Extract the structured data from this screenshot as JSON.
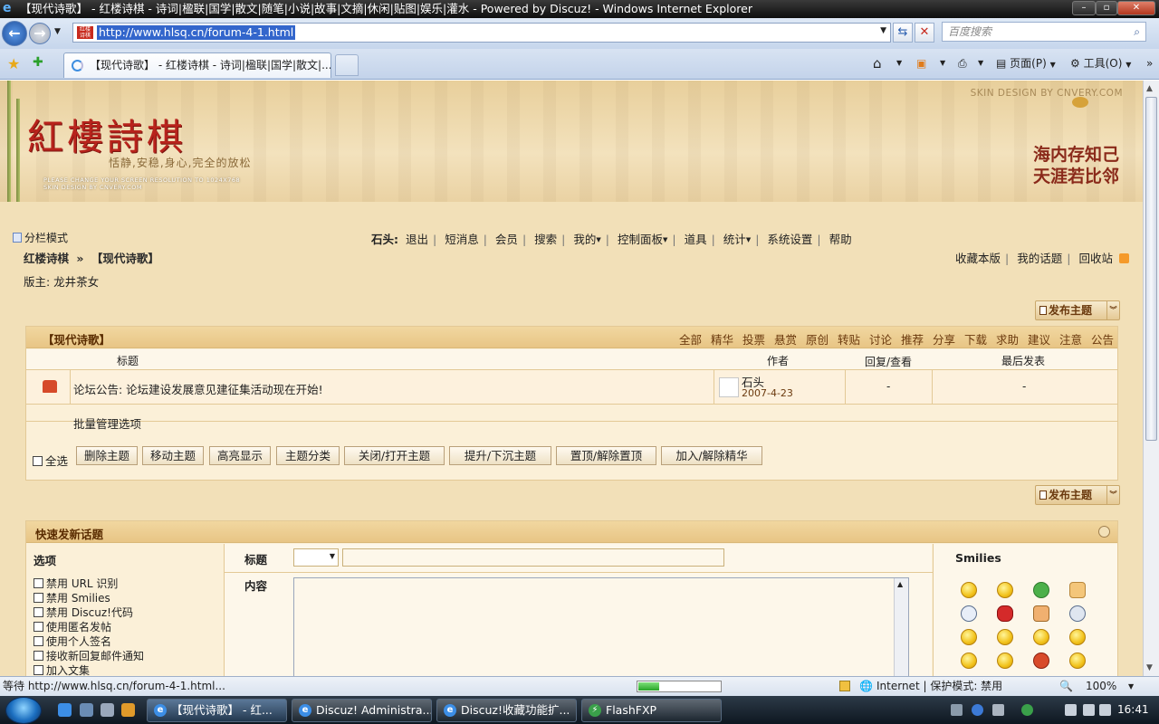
{
  "window": {
    "title": "【现代诗歌】 - 红楼诗棋 - 诗词|楹联|国学|散文|随笔|小说|故事|文摘|休闲|贴图|娱乐|灌水 - Powered by Discuz! - Windows Internet Explorer"
  },
  "address": {
    "url": "http://www.hlsq.cn/forum-4-1.html",
    "search_placeholder": "百度搜索"
  },
  "tabs": {
    "active_label": "【现代诗歌】 - 红楼诗棋 - 诗词|楹联|国学|散文|...",
    "page_menu": "页面(P)",
    "tools_menu": "工具(O)"
  },
  "banner": {
    "logo": "紅樓詩棋",
    "motto": "恬静,安稳,身心,完全的放松",
    "resolution_note": "PLEASE CHANGE YOUR SCREEN RESOLUTION TO 1024X768",
    "skin_note": "SKIN DESIGN BY CNVERY.COM",
    "skin_credit": "SKIN DESIGN BY CNVERY.COM",
    "poem_line1": "海内存知己",
    "poem_line2": "天涯若比邻"
  },
  "toolbar": {
    "split_mode": "分栏模式",
    "username": "石头:",
    "items": [
      "退出",
      "短消息",
      "会员",
      "搜索",
      "我的",
      "控制面板",
      "道具",
      "统计",
      "系统设置",
      "帮助"
    ]
  },
  "breadcrumb": {
    "home": "红楼诗棋",
    "arrow": "»",
    "current": "【现代诗歌】"
  },
  "right_links": [
    "收藏本版",
    "我的话题",
    "回收站"
  ],
  "moderator": "版主: 龙井茶女",
  "post_button": "发布主题",
  "forum": {
    "name": "【现代诗歌】",
    "filters": [
      "全部",
      "精华",
      "投票",
      "悬赏",
      "原创",
      "转贴",
      "讨论",
      "推荐",
      "分享",
      "下载",
      "求助",
      "建议",
      "注意",
      "公告"
    ],
    "columns": {
      "title": "标题",
      "author": "作者",
      "replies": "回复/查看",
      "lastpost": "最后发表"
    },
    "thread": {
      "title": "论坛公告: 论坛建设发展意见建征集活动现在开始!",
      "author": "石头",
      "date": "2007-4-23",
      "replies": "-",
      "lastpost": "-"
    },
    "batch_label": "批量管理选项",
    "select_all": "全选",
    "batch_buttons": [
      "删除主题",
      "移动主题",
      "高亮显示",
      "主题分类",
      "关闭/打开主题",
      "提升/下沉主题",
      "置顶/解除置顶",
      "加入/解除精华"
    ]
  },
  "quick_post": {
    "title": "快速发新话题",
    "options_head": "选项",
    "options": [
      "禁用 URL 识别",
      "禁用 Smilies",
      "禁用 Discuz!代码",
      "使用匿名发帖",
      "使用个人签名",
      "接收新回复邮件通知",
      "加入文集"
    ],
    "subject_label": "标题",
    "content_label": "内容",
    "smilies_head": "Smilies"
  },
  "status": {
    "text": "等待 http://www.hlsq.cn/forum-4-1.html...",
    "progress": 0.25,
    "zone": "Internet | 保护模式: 禁用",
    "zoom": "100%"
  },
  "taskbar": {
    "tasks": [
      "【现代诗歌】 - 红...",
      "Discuz! Administra...",
      "Discuz!收藏功能扩...",
      "FlashFXP"
    ],
    "clock": "16:41"
  }
}
